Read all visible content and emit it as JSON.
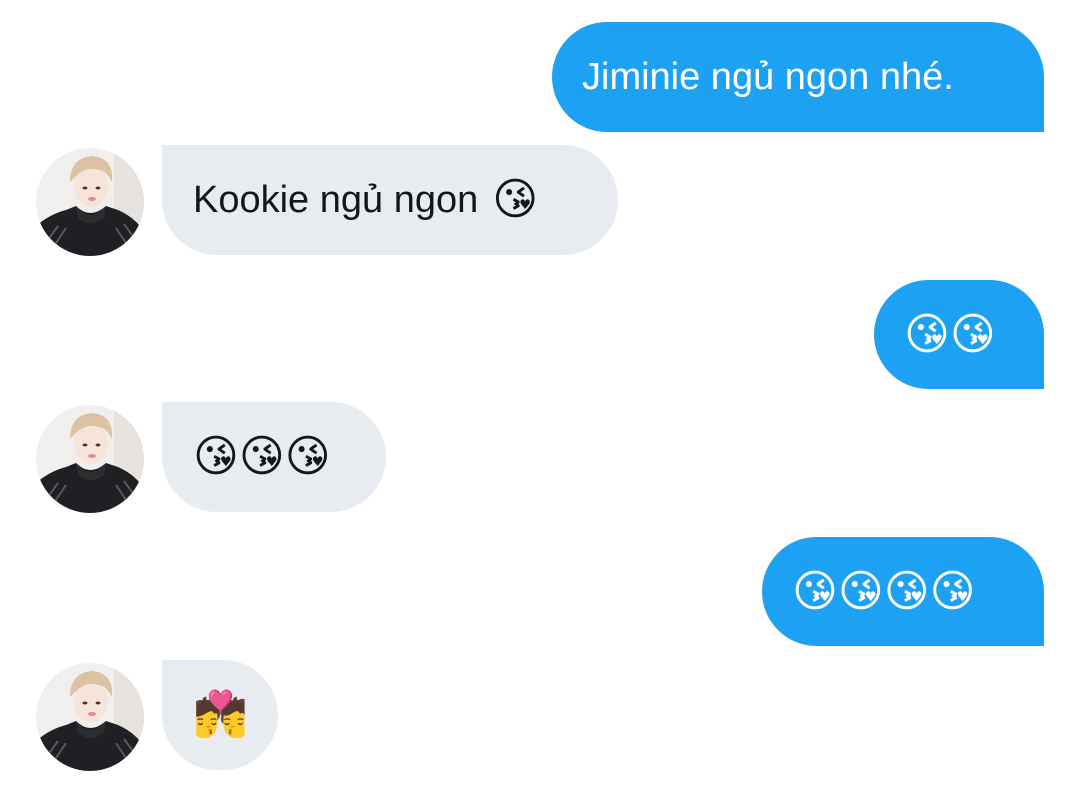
{
  "conversation": {
    "messages": [
      {
        "id": "m1",
        "direction": "outgoing",
        "text": "Jiminie ngủ ngon nhé.",
        "emoji": ""
      },
      {
        "id": "m2",
        "direction": "incoming",
        "text": "Kookie ngủ ngon",
        "emoji": "😘"
      },
      {
        "id": "m3",
        "direction": "outgoing",
        "text": "",
        "emoji": "😘😘"
      },
      {
        "id": "m4",
        "direction": "incoming",
        "text": "",
        "emoji": "😘😘😘"
      },
      {
        "id": "m5",
        "direction": "outgoing",
        "text": "",
        "emoji": "😘😘😘😘"
      },
      {
        "id": "m6",
        "direction": "incoming",
        "text": "",
        "emoji": "💏"
      }
    ]
  },
  "colors": {
    "outgoing_bubble": "#1da1f2",
    "outgoing_text": "#ffffff",
    "incoming_bubble": "#e8ecf0",
    "incoming_text": "#14171a",
    "background": "#ffffff"
  },
  "icons": {
    "avatar": "contact-avatar-photo"
  }
}
